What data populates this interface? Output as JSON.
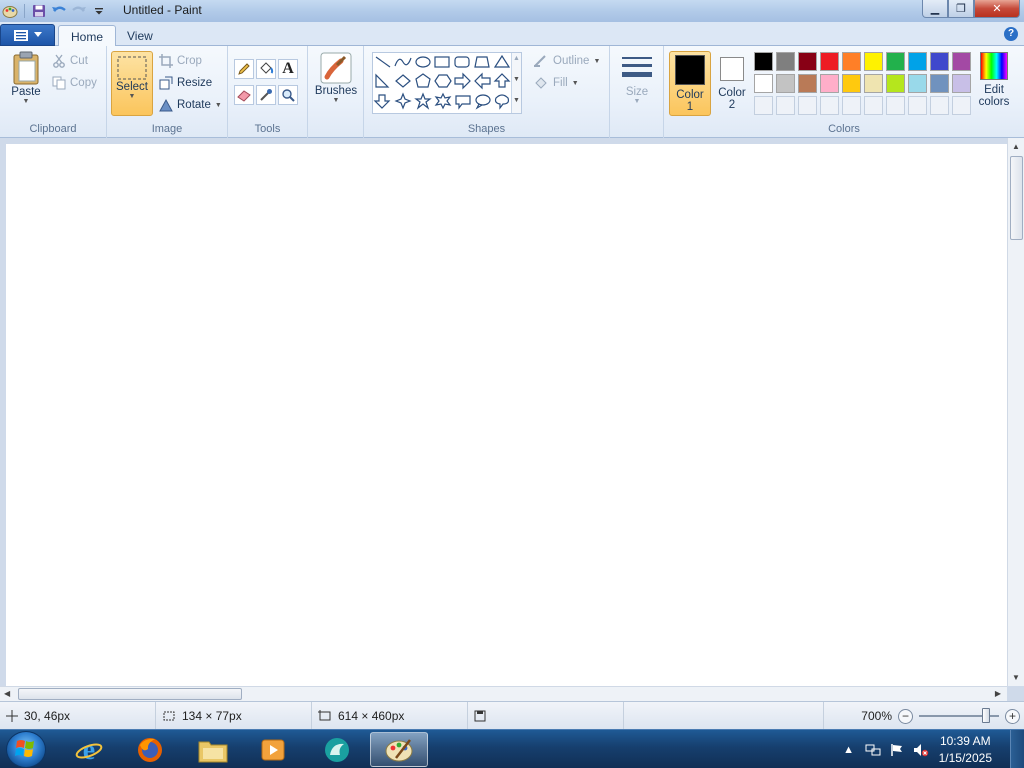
{
  "window": {
    "title": "Untitled - Paint",
    "controls": {
      "minimize": "▁",
      "maximize": "❐",
      "close": "✕"
    }
  },
  "tabs": [
    {
      "label": "Home",
      "active": true
    },
    {
      "label": "View",
      "active": false
    }
  ],
  "help_label": "?",
  "ribbon": {
    "clipboard": {
      "label": "Clipboard",
      "paste": "Paste",
      "cut": "Cut",
      "copy": "Copy"
    },
    "image": {
      "label": "Image",
      "select": "Select",
      "crop": "Crop",
      "resize": "Resize",
      "rotate": "Rotate"
    },
    "tools": {
      "label": "Tools",
      "items": [
        "pencil-icon",
        "fill-bucket-icon",
        "text-icon",
        "eraser-icon",
        "color-picker-icon",
        "magnifier-icon"
      ],
      "text_glyph": "A"
    },
    "brushes": {
      "label": "Brushes"
    },
    "shapes": {
      "label": "Shapes",
      "outline": "Outline",
      "fill": "Fill"
    },
    "size": {
      "label": "Size"
    },
    "colors": {
      "label": "Colors",
      "color1": {
        "label_line1": "Color",
        "label_line2": "1",
        "value": "#000000"
      },
      "color2": {
        "label_line1": "Color",
        "label_line2": "2",
        "value": "#ffffff"
      },
      "edit": {
        "label_line1": "Edit",
        "label_line2": "colors"
      },
      "palette_row1": [
        "#000000",
        "#7f7f7f",
        "#880015",
        "#ed1c24",
        "#ff7f27",
        "#fff200",
        "#22b14c",
        "#00a2e8",
        "#3f48cc",
        "#a349a4"
      ],
      "palette_row2": [
        "#ffffff",
        "#c3c3c3",
        "#b97a57",
        "#ffaec9",
        "#ffc90e",
        "#efe4b0",
        "#b5e61d",
        "#99d9ea",
        "#7092be",
        "#c8bfe7"
      ]
    }
  },
  "statusbar": {
    "cursor": "30, 46px",
    "selection": "134 × 77px",
    "canvas_size": "614 × 460px",
    "zoom": "700%",
    "zoom_level": 0.88
  },
  "taskbar": {
    "apps": [
      "internet-explorer-icon",
      "firefox-icon",
      "file-explorer-icon",
      "media-player-icon",
      "app-icon",
      "paint-icon"
    ],
    "clock_time": "10:39 AM",
    "clock_date": "1/15/2025"
  }
}
